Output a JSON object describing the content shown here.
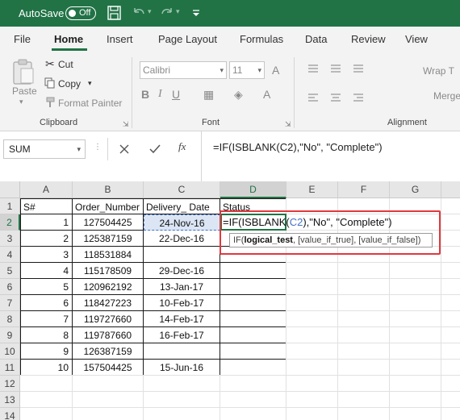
{
  "titlebar": {
    "autosave_label": "AutoSave",
    "autosave_state": "Off"
  },
  "ribbon_tabs": [
    "File",
    "Home",
    "Insert",
    "Page Layout",
    "Formulas",
    "Data",
    "Review",
    "View"
  ],
  "active_tab": "Home",
  "clipboard": {
    "paste": "Paste",
    "cut": "Cut",
    "copy": "Copy",
    "format_painter": "Format Painter",
    "group_label": "Clipboard"
  },
  "font": {
    "name": "Calibri",
    "size": "11",
    "group_label": "Font"
  },
  "alignment": {
    "wrap": "Wrap T",
    "merge": "Merge",
    "group_label": "Alignment"
  },
  "formula_bar": {
    "name_box": "SUM",
    "fx": "fx",
    "formula": "=IF(ISBLANK(C2),\"No\", \"Complete\")"
  },
  "columns": [
    "A",
    "B",
    "C",
    "D",
    "E",
    "F",
    "G"
  ],
  "rows": [
    "1",
    "2",
    "3",
    "4",
    "5",
    "6",
    "7",
    "8",
    "9",
    "10",
    "11",
    "12",
    "13",
    "14"
  ],
  "headers": {
    "a": "S#",
    "b": "Order_Number",
    "c": "Delivery_ Date",
    "d": "Status"
  },
  "table": [
    {
      "sn": "1",
      "order": "127504425",
      "date": "24-Nov-16"
    },
    {
      "sn": "2",
      "order": "125387159",
      "date": "22-Dec-16"
    },
    {
      "sn": "3",
      "order": "118531884",
      "date": ""
    },
    {
      "sn": "4",
      "order": "115178509",
      "date": "29-Dec-16"
    },
    {
      "sn": "5",
      "order": "120962192",
      "date": "13-Jan-17"
    },
    {
      "sn": "6",
      "order": "118427223",
      "date": "10-Feb-17"
    },
    {
      "sn": "7",
      "order": "119727660",
      "date": "14-Feb-17"
    },
    {
      "sn": "8",
      "order": "119787660",
      "date": "16-Feb-17"
    },
    {
      "sn": "9",
      "order": "126387159",
      "date": ""
    },
    {
      "sn": "10",
      "order": "157504425",
      "date": "15-Jun-16"
    }
  ],
  "edit": {
    "prefix": "=IF(ISBLANK(",
    "ref": "C2",
    "suffix": "),\"No\", \"Complete\")"
  },
  "tooltip": {
    "func": "IF(",
    "arg1": "logical_test",
    "rest": ", [value_if_true], [value_if_false])"
  },
  "colors": {
    "excel_green": "#217346",
    "highlight_red": "#e0393e",
    "reference_blue": "#4472c4"
  }
}
